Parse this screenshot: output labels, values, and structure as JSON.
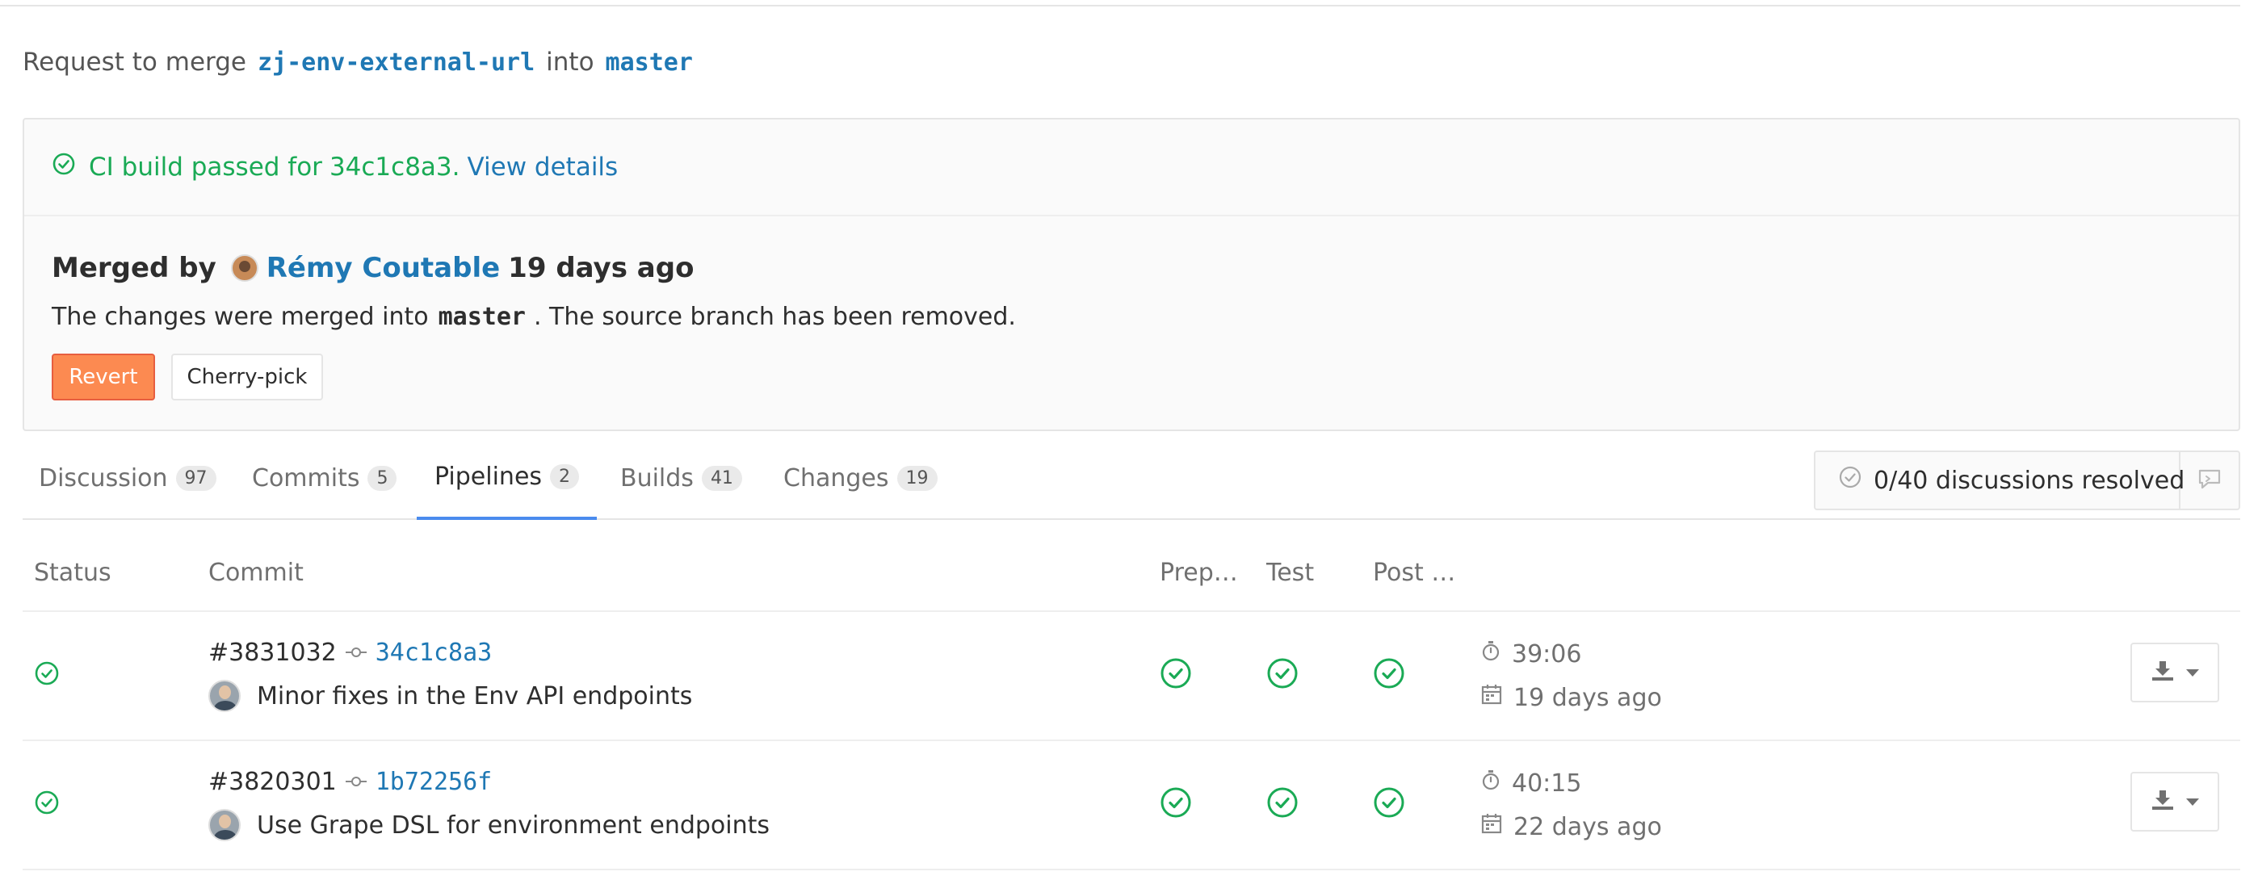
{
  "merge_request": {
    "prefix": "Request to merge",
    "source_branch": "zj-env-external-url",
    "into": "into",
    "target_branch": "master"
  },
  "ci_status": {
    "text": "CI build passed for",
    "sha": "34c1c8a3.",
    "link": "View details",
    "color": "#1aaa55"
  },
  "merged": {
    "label": "Merged by",
    "user": "Rémy Coutable",
    "time": "19 days ago",
    "desc_prefix": "The changes were merged into",
    "desc_branch": "master",
    "desc_suffix": ". The source branch has been removed.",
    "revert_label": "Revert",
    "cherry_pick_label": "Cherry-pick"
  },
  "tabs": [
    {
      "label": "Discussion",
      "count": "97",
      "active": false
    },
    {
      "label": "Commits",
      "count": "5",
      "active": false
    },
    {
      "label": "Pipelines",
      "count": "2",
      "active": true
    },
    {
      "label": "Builds",
      "count": "41",
      "active": false
    },
    {
      "label": "Changes",
      "count": "19",
      "active": false
    }
  ],
  "discussions": {
    "resolved_text": "0/40 discussions resolved"
  },
  "table": {
    "headers": {
      "status": "Status",
      "commit": "Commit",
      "stage1": "Prep…",
      "stage2": "Test",
      "stage3": "Post …"
    },
    "rows": [
      {
        "pipeline_id": "#3831032",
        "sha": "34c1c8a3",
        "message": "Minor fixes in the Env API endpoints",
        "duration": "39:06",
        "finished": "19 days ago"
      },
      {
        "pipeline_id": "#3820301",
        "sha": "1b72256f",
        "message": "Use Grape DSL for environment endpoints",
        "duration": "40:15",
        "finished": "22 days ago"
      }
    ]
  },
  "icons": {
    "status": "check-circle-icon",
    "commit": "commit-icon",
    "duration": "stopwatch-icon",
    "finished": "calendar-icon",
    "download": "download-icon",
    "discussion_reply": "comment-icon"
  },
  "colors": {
    "success": "#1aaa55",
    "link": "#1f78b4",
    "revert": "#fc8a51",
    "active_tab": "#4a8bee"
  }
}
